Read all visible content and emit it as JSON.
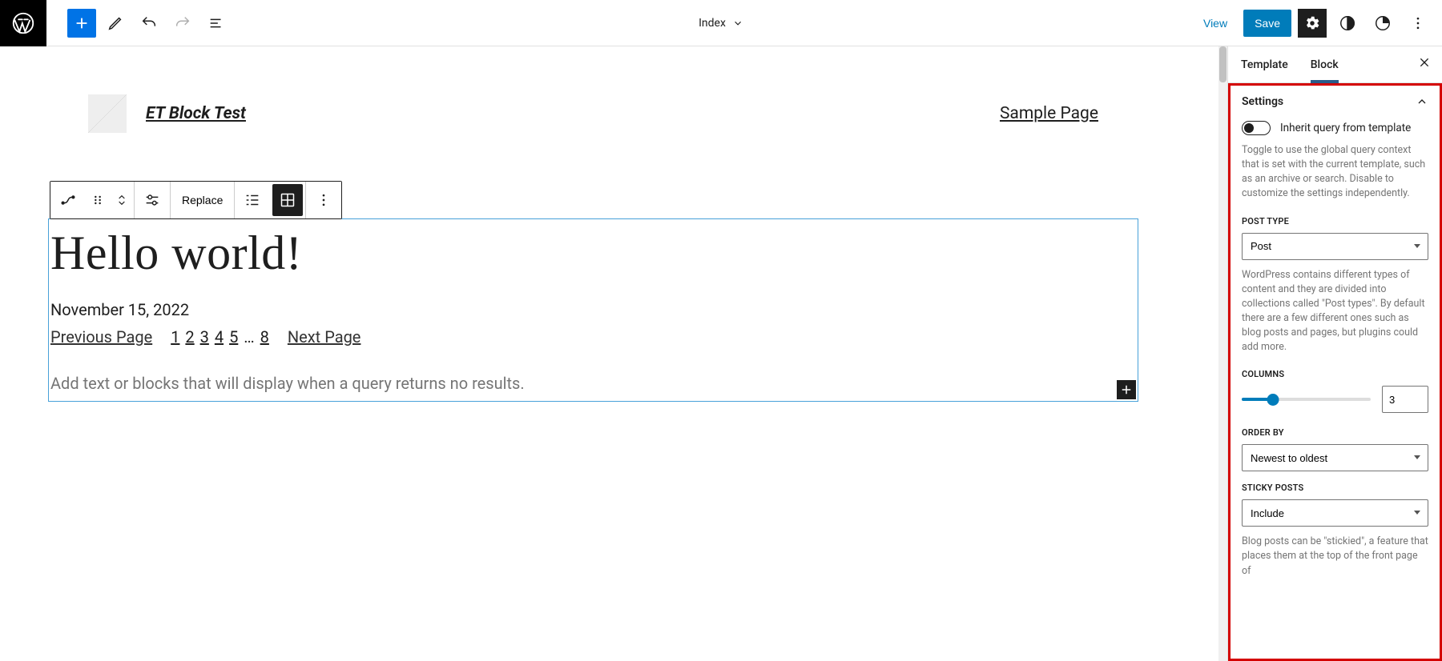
{
  "topbar": {
    "center_title": "Index",
    "view": "View",
    "save": "Save"
  },
  "site": {
    "title": "ET Block Test",
    "nav_link": "Sample Page"
  },
  "toolbar": {
    "replace": "Replace"
  },
  "post": {
    "title": "Hello world!",
    "date": "November 15, 2022"
  },
  "pagination": {
    "prev": "Previous Page",
    "next": "Next Page",
    "nums": [
      "1",
      "2",
      "3",
      "4",
      "5",
      "…",
      "8"
    ]
  },
  "no_results_placeholder": "Add text or blocks that will display when a query returns no results.",
  "sidebar": {
    "tabs": {
      "template": "Template",
      "block": "Block"
    },
    "settings_title": "Settings",
    "inherit_label": "Inherit query from template",
    "inherit_help": "Toggle to use the global query context that is set with the current template, such as an archive or search. Disable to customize the settings independently.",
    "post_type_label": "POST TYPE",
    "post_type_value": "Post",
    "post_type_help": "WordPress contains different types of content and they are divided into collections called \"Post types\". By default there are a few different ones such as blog posts and pages, but plugins could add more.",
    "columns_label": "COLUMNS",
    "columns_value": "3",
    "columns_max": 12,
    "order_by_label": "ORDER BY",
    "order_by_value": "Newest to oldest",
    "sticky_label": "STICKY POSTS",
    "sticky_value": "Include",
    "sticky_help": "Blog posts can be \"stickied\", a feature that places them at the top of the front page of"
  }
}
